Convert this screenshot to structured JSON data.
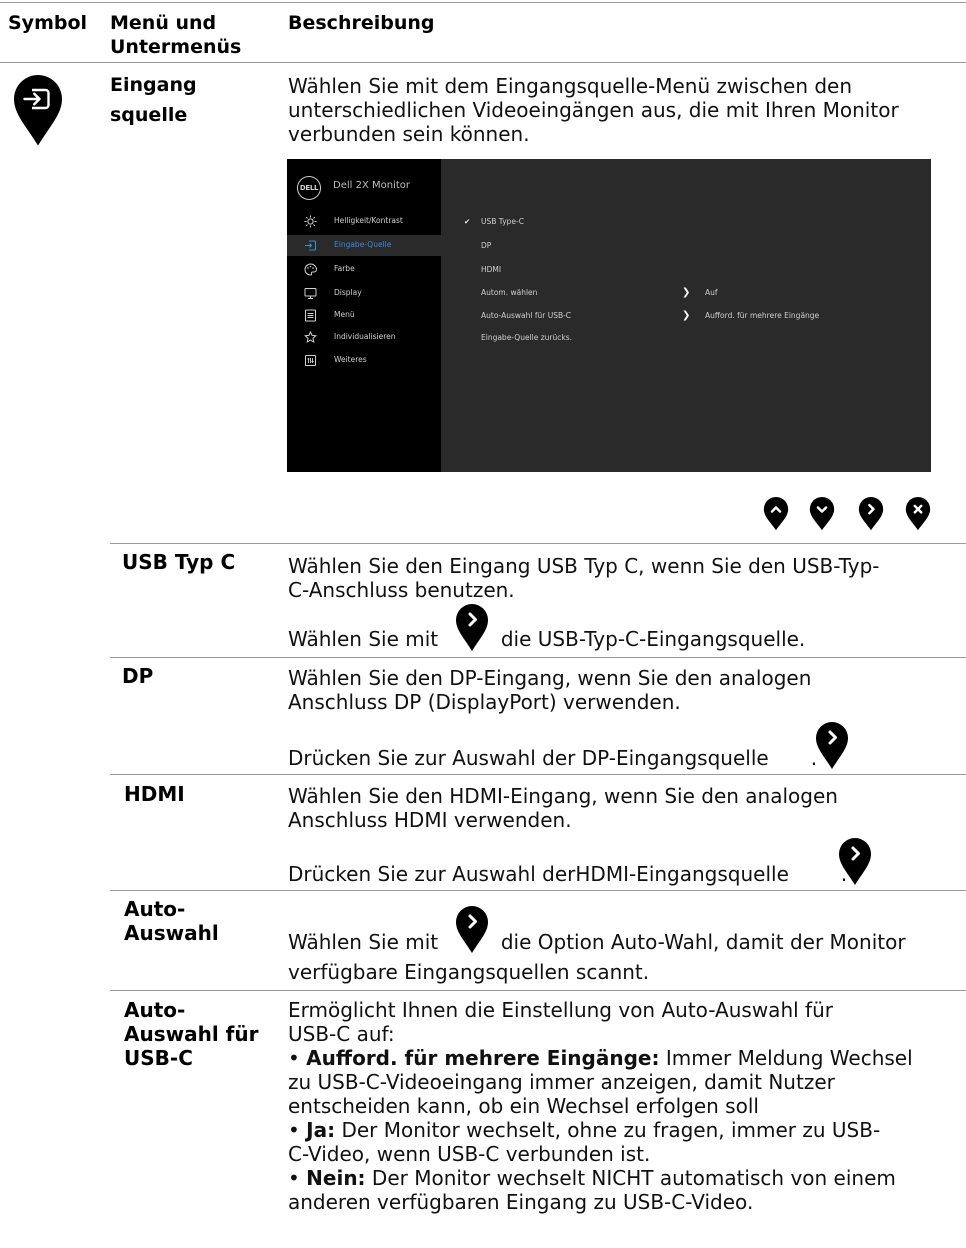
{
  "header": {
    "symbol": "Symbol",
    "menu": "Menü und Untermenüs",
    "menu_line1": "Menü und",
    "menu_line2": "Untermenüs",
    "description": "Beschreibung"
  },
  "main_row": {
    "icon": "input-source-icon",
    "title_line1": "Eingang",
    "title_line2": "squelle",
    "desc_line1": "Wählen Sie mit dem Eingangsquelle-Menü zwischen den",
    "desc_line2": "unterschiedlichen Videoeingängen aus, die mit Ihren Monitor",
    "desc_line3": "verbunden sein können."
  },
  "osd": {
    "logo": "DELL",
    "title": "Dell 2X Monitor",
    "menu_items": [
      {
        "label": "Helligkeit/Kontrast",
        "icon": "brightness-icon"
      },
      {
        "label": "Eingabe-Quelle",
        "icon": "input-source-icon",
        "selected": true
      },
      {
        "label": "Farbe",
        "icon": "color-palette-icon"
      },
      {
        "label": "Display",
        "icon": "display-icon"
      },
      {
        "label": "Menü",
        "icon": "menu-icon"
      },
      {
        "label": "Individualisieren",
        "icon": "star-icon"
      },
      {
        "label": "Weiteres",
        "icon": "other-icon"
      }
    ],
    "options": [
      {
        "label": "USB Type-C",
        "checked": true
      },
      {
        "label": "DP"
      },
      {
        "label": "HDMI"
      },
      {
        "label": "Autom. wählen",
        "value": "Auf"
      },
      {
        "label": "Auto-Auswahl für USB-C",
        "value": "Aufford. für mehrere Eingänge"
      },
      {
        "label": "Eingabe-Quelle zurücks."
      }
    ],
    "check_glyph": "✔",
    "chevron_glyph": "❯"
  },
  "nav_buttons": [
    "up-button-icon",
    "down-button-icon",
    "right-button-icon",
    "close-button-icon"
  ],
  "rows": [
    {
      "title": "USB Typ C",
      "desc_line1": "Wählen Sie den Eingang USB Typ C, wenn Sie den USB-Typ-",
      "desc_line2": "C-Anschluss benutzen.",
      "select_pre": "Wählen Sie mit",
      "select_post": "die USB-Typ-C-Eingangsquelle."
    },
    {
      "title": "DP",
      "desc_line1": "Wählen Sie den DP-Eingang, wenn Sie den analogen",
      "desc_line2": "Anschluss DP (DisplayPort) verwenden.",
      "select_pre": "Drücken Sie zur Auswahl der DP-Eingangsquelle",
      "select_post": "."
    },
    {
      "title": "HDMI",
      "desc_line1": "Wählen Sie den HDMI-Eingang, wenn Sie den analogen",
      "desc_line2": "Anschluss HDMI verwenden.",
      "select_pre": "Drücken Sie zur Auswahl derHDMI-Eingangsquelle",
      "select_post": "."
    },
    {
      "title_line1": "Auto-",
      "title_line2": "Auswahl",
      "select_pre": "Wählen Sie mit",
      "select_post": "die Option Auto-Wahl, damit der Monitor",
      "desc_line2": "verfügbare Eingangsquellen scannt."
    },
    {
      "title_line1": "Auto-",
      "title_line2": "Auswahl für",
      "title_line3": "USB-C",
      "intro_line1": "Ermöglicht Ihnen die Einstellung von Auto-Auswahl für",
      "intro_line2": "USB-C auf:",
      "bullet": "•",
      "opt1_label": "Aufford. für mehrere Eingänge:",
      "opt1_line1": "Immer Meldung Wechsel",
      "opt1_line2": "zu USB-C-Videoeingang immer anzeigen, damit Nutzer",
      "opt1_line3": "entscheiden kann, ob ein Wechsel erfolgen soll",
      "opt2_label": "Ja:",
      "opt2_line1": "Der Monitor wechselt, ohne zu fragen, immer zu USB-",
      "opt2_line2": "C-Video, wenn USB-C verbunden ist.",
      "opt3_label": "Nein:",
      "opt3_line1": "Der Monitor wechselt NICHT automatisch von einem",
      "opt3_line2": "anderen verfügbaren Eingang zu USB-C-Video."
    }
  ]
}
